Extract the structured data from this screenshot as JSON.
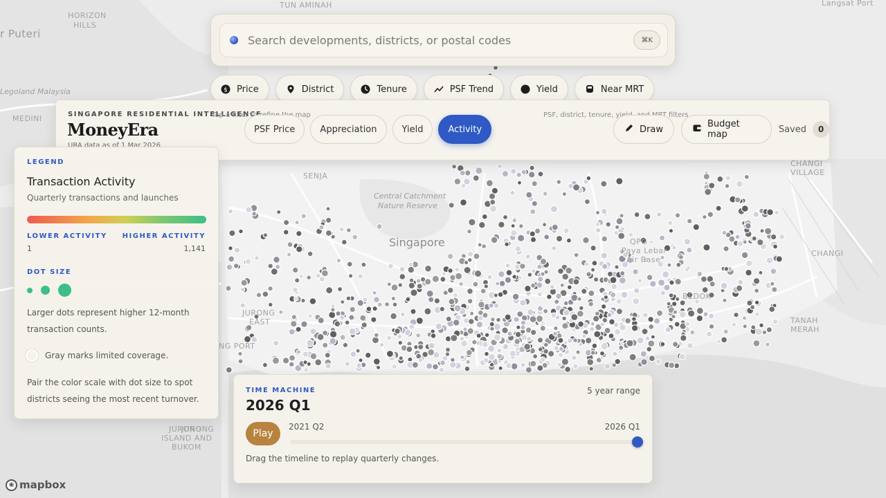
{
  "search": {
    "placeholder": "Search developments, districts, or postal codes",
    "shortcut": "⌘K"
  },
  "filters": [
    {
      "label": "Price",
      "icon": "price-tag-icon"
    },
    {
      "label": "District",
      "icon": "map-pin-icon"
    },
    {
      "label": "Tenure",
      "icon": "clock-icon"
    },
    {
      "label": "PSF Trend",
      "icon": "trend-line-icon"
    },
    {
      "label": "Yield",
      "icon": "yield-circle-icon"
    },
    {
      "label": "Near MRT",
      "icon": "train-icon"
    }
  ],
  "header": {
    "kicker": "SINGAPORE RESIDENTIAL INTELLIGENCE",
    "brand": "MoneyEra",
    "data_note": "URA data as of 1 Mar 2026",
    "hint_left": "Tap a filter to refine the map",
    "hint_right": "PSF, district, tenure, yield, and MRT filters",
    "layers": [
      {
        "label": "PSF Price",
        "active": false
      },
      {
        "label": "Appreciation",
        "active": false
      },
      {
        "label": "Yield",
        "active": false
      },
      {
        "label": "Activity",
        "active": true
      }
    ],
    "draw_label": "Draw",
    "budget_label": "Budget map",
    "saved_label": "Saved",
    "saved_count": "0"
  },
  "legend": {
    "kicker": "LEGEND",
    "title": "Transaction Activity",
    "subtitle": "Quarterly transactions and launches",
    "lower_label": "LOWER ACTIVITY",
    "higher_label": "HIGHER ACTIVITY",
    "min_value": "1",
    "max_value": "1,141",
    "dot_size_label": "DOT SIZE",
    "dot_size_text": "Larger dots represent higher 12-month transaction counts.",
    "gray_text": "Gray marks limited coverage.",
    "footer_text": "Pair the color scale with dot size to spot districts seeing the most recent turnover.",
    "colors": {
      "low": "#ef5a4f",
      "mid": "#cfcf55",
      "high": "#3cbf86"
    }
  },
  "time_machine": {
    "kicker": "TIME MACHINE",
    "current": "2026 Q1",
    "range_label": "5 year range",
    "play_label": "Play",
    "start": "2021 Q2",
    "end": "2026 Q1",
    "position": 1.0,
    "help": "Drag the timeline to replay quarterly changes."
  },
  "map": {
    "labels": [
      "TUN AMINAH",
      "HORIZON",
      "HILLS",
      "r Puteri",
      "Legoland Malaysia",
      "MEDINI",
      "SENJA",
      "Central Catchment",
      "Nature Reserve",
      "Singapore",
      "QPG -",
      "Paya Lebar",
      "Air Base",
      "CHANGI",
      "VILLAGE",
      "CHANGI",
      "BEDOK",
      "TANAH",
      "MERAH",
      "JURONG",
      "EAST",
      "NG PORT",
      "JURONG",
      "JURONG",
      "ISLAND AND",
      "BUKOM",
      "Langsat Port"
    ],
    "attribution": "mapbox"
  }
}
